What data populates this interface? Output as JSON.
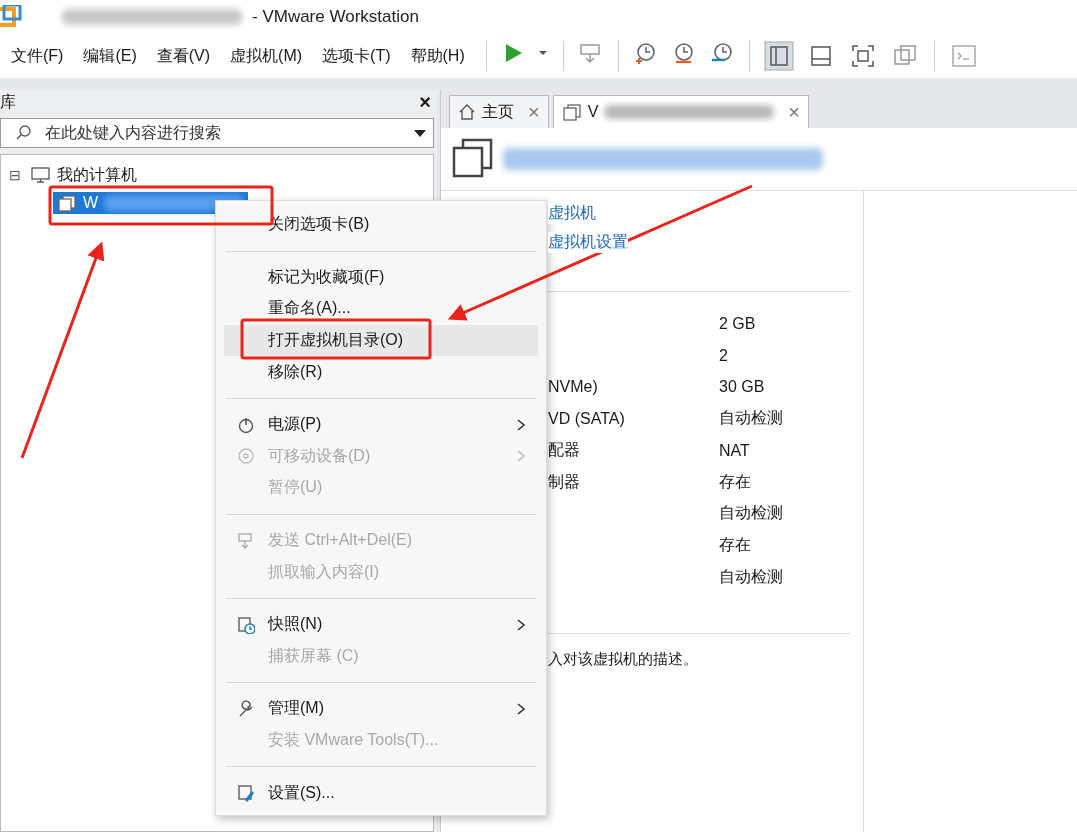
{
  "window": {
    "title": "- VMware Workstation"
  },
  "menubar": [
    "文件(F)",
    "编辑(E)",
    "查看(V)",
    "虚拟机(M)",
    "选项卡(T)",
    "帮助(H)"
  ],
  "library": {
    "title": "库",
    "close": "×",
    "search": {
      "placeholder": "在此处键入内容进行搜索"
    },
    "tree": [
      {
        "label": "我的计算机",
        "expander": "⊟",
        "children": [
          {
            "label": "W",
            "selected": true
          }
        ]
      }
    ]
  },
  "tabs": [
    {
      "label": "主页",
      "close": "×",
      "selected": false
    },
    {
      "label": "V",
      "close": "×",
      "selected": true
    }
  ],
  "vm_panel": {
    "links": [
      "虚拟机",
      "虚拟机设置"
    ],
    "devices": [
      {
        "value": "2 GB"
      },
      {
        "value": "2"
      },
      {
        "name": "NVMe)",
        "value": "30 GB"
      },
      {
        "name": "VD (SATA)",
        "value": "自动检测"
      },
      {
        "name": "配器",
        "value": "NAT"
      },
      {
        "name": "制器",
        "value": "存在"
      },
      {
        "value": "自动检测"
      },
      {
        "value": "存在"
      },
      {
        "value": "自动检测"
      }
    ],
    "description": "入对该虚拟机的描述。"
  },
  "context_menu": [
    {
      "kind": "item",
      "label": "关闭选项卡(B)",
      "disabled": false,
      "submenu": false,
      "selected": false
    },
    {
      "kind": "separator"
    },
    {
      "kind": "item",
      "label": "标记为收藏项(F)",
      "disabled": false,
      "submenu": false,
      "selected": false
    },
    {
      "kind": "item",
      "label": "重命名(A)...",
      "disabled": false,
      "submenu": false,
      "selected": false
    },
    {
      "kind": "item",
      "label": "打开虚拟机目录(O)",
      "disabled": false,
      "submenu": false,
      "selected": true
    },
    {
      "kind": "item",
      "label": "移除(R)",
      "disabled": false,
      "submenu": false,
      "selected": false
    },
    {
      "kind": "separator"
    },
    {
      "kind": "item",
      "label": "电源(P)",
      "disabled": false,
      "submenu": true,
      "selected": false
    },
    {
      "kind": "item",
      "label": "可移动设备(D)",
      "disabled": true,
      "submenu": true,
      "selected": false
    },
    {
      "kind": "item",
      "label": "暂停(U)",
      "disabled": true,
      "submenu": false,
      "selected": false
    },
    {
      "kind": "separator"
    },
    {
      "kind": "item",
      "label": "发送 Ctrl+Alt+Del(E)",
      "disabled": true,
      "submenu": false,
      "selected": false
    },
    {
      "kind": "item",
      "label": "抓取输入内容(I)",
      "disabled": true,
      "submenu": false,
      "selected": false
    },
    {
      "kind": "separator"
    },
    {
      "kind": "item",
      "label": "快照(N)",
      "disabled": false,
      "submenu": true,
      "selected": false
    },
    {
      "kind": "item",
      "label": "捕获屏幕 (C)",
      "disabled": true,
      "submenu": false,
      "selected": false
    },
    {
      "kind": "separator"
    },
    {
      "kind": "item",
      "label": "管理(M)",
      "disabled": false,
      "submenu": true,
      "selected": false
    },
    {
      "kind": "item",
      "label": "安装 VMware Tools(T)...",
      "disabled": true,
      "submenu": false,
      "selected": false
    },
    {
      "kind": "separator"
    },
    {
      "kind": "item",
      "label": "设置(S)...",
      "disabled": false,
      "submenu": false,
      "selected": false
    }
  ]
}
